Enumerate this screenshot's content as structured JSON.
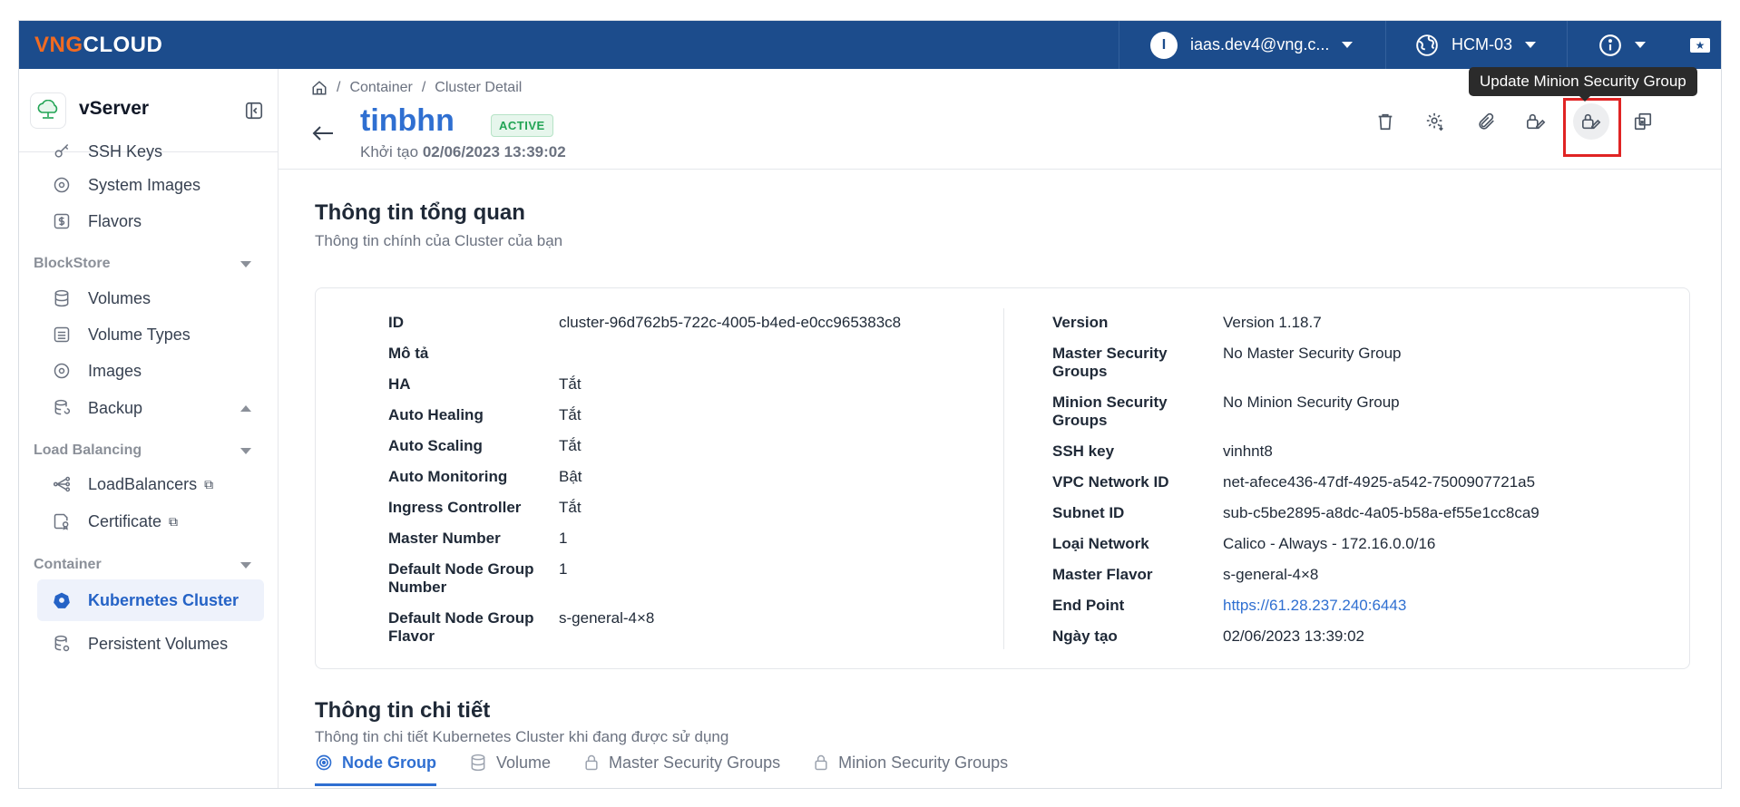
{
  "topbar": {
    "logo_brand": "VNG",
    "logo_rest": "CLOUD",
    "user_initial": "I",
    "user_email": "iaas.dev4@vng.c...",
    "region": "HCM-03"
  },
  "sidebar": {
    "title": "vServer",
    "items_top": [
      {
        "label": "SSH Keys"
      },
      {
        "label": "System Images"
      },
      {
        "label": "Flavors"
      }
    ],
    "sections": {
      "blockstore": "BlockStore",
      "load_balancing": "Load Balancing",
      "container": "Container"
    },
    "blockstore_items": [
      {
        "label": "Volumes"
      },
      {
        "label": "Volume Types"
      },
      {
        "label": "Images"
      },
      {
        "label": "Backup"
      }
    ],
    "lb_items": [
      {
        "label": "LoadBalancers"
      },
      {
        "label": "Certificate"
      }
    ],
    "container_items": [
      {
        "label": "Kubernetes Cluster"
      },
      {
        "label": "Persistent Volumes"
      }
    ]
  },
  "header": {
    "breadcrumb": [
      "Container",
      "Cluster Detail"
    ],
    "title": "tinbhn",
    "status": "ACTIVE",
    "created_label": "Khởi tạo",
    "created_value": "02/06/2023 13:39:02",
    "tooltip": "Update Minion Security Group"
  },
  "overview": {
    "title": "Thông tin tổng quan",
    "subtitle": "Thông tin chính của Cluster của bạn",
    "left": [
      {
        "label": "ID",
        "value": "cluster-96d762b5-722c-4005-b4ed-e0cc965383c8"
      },
      {
        "label": "Mô tả",
        "value": ""
      },
      {
        "label": "HA",
        "value": "Tắt"
      },
      {
        "label": "Auto Healing",
        "value": "Tắt"
      },
      {
        "label": "Auto Scaling",
        "value": "Tắt"
      },
      {
        "label": "Auto Monitoring",
        "value": "Bật"
      },
      {
        "label": "Ingress Controller",
        "value": "Tắt"
      },
      {
        "label": "Master Number",
        "value": "1"
      },
      {
        "label": "Default Node Group Number",
        "value": "1"
      },
      {
        "label": "Default Node Group Flavor",
        "value": "s-general-4×8"
      }
    ],
    "right": [
      {
        "label": "Version",
        "value": "Version 1.18.7"
      },
      {
        "label": "Master Security Groups",
        "value": "No Master Security Group"
      },
      {
        "label": "Minion Security Groups",
        "value": "No Minion Security Group"
      },
      {
        "label": "SSH key",
        "value": "vinhnt8"
      },
      {
        "label": "VPC Network ID",
        "value": "net-afece436-47df-4925-a542-7500907721a5"
      },
      {
        "label": "Subnet ID",
        "value": "sub-c5be2895-a8dc-4a05-b58a-ef55e1cc8ca9"
      },
      {
        "label": "Loại Network",
        "value": "Calico - Always - 172.16.0.0/16"
      },
      {
        "label": "Master Flavor",
        "value": "s-general-4×8"
      },
      {
        "label": "End Point",
        "value": "https://61.28.237.240:6443"
      },
      {
        "label": "Ngày tạo",
        "value": "02/06/2023 13:39:02"
      }
    ]
  },
  "detail": {
    "title": "Thông tin chi tiết",
    "subtitle": "Thông tin chi tiết Kubernetes Cluster khi đang được sử dụng",
    "tabs": [
      {
        "label": "Node Group"
      },
      {
        "label": "Volume"
      },
      {
        "label": "Master Security Groups"
      },
      {
        "label": "Minion Security Groups"
      }
    ]
  }
}
